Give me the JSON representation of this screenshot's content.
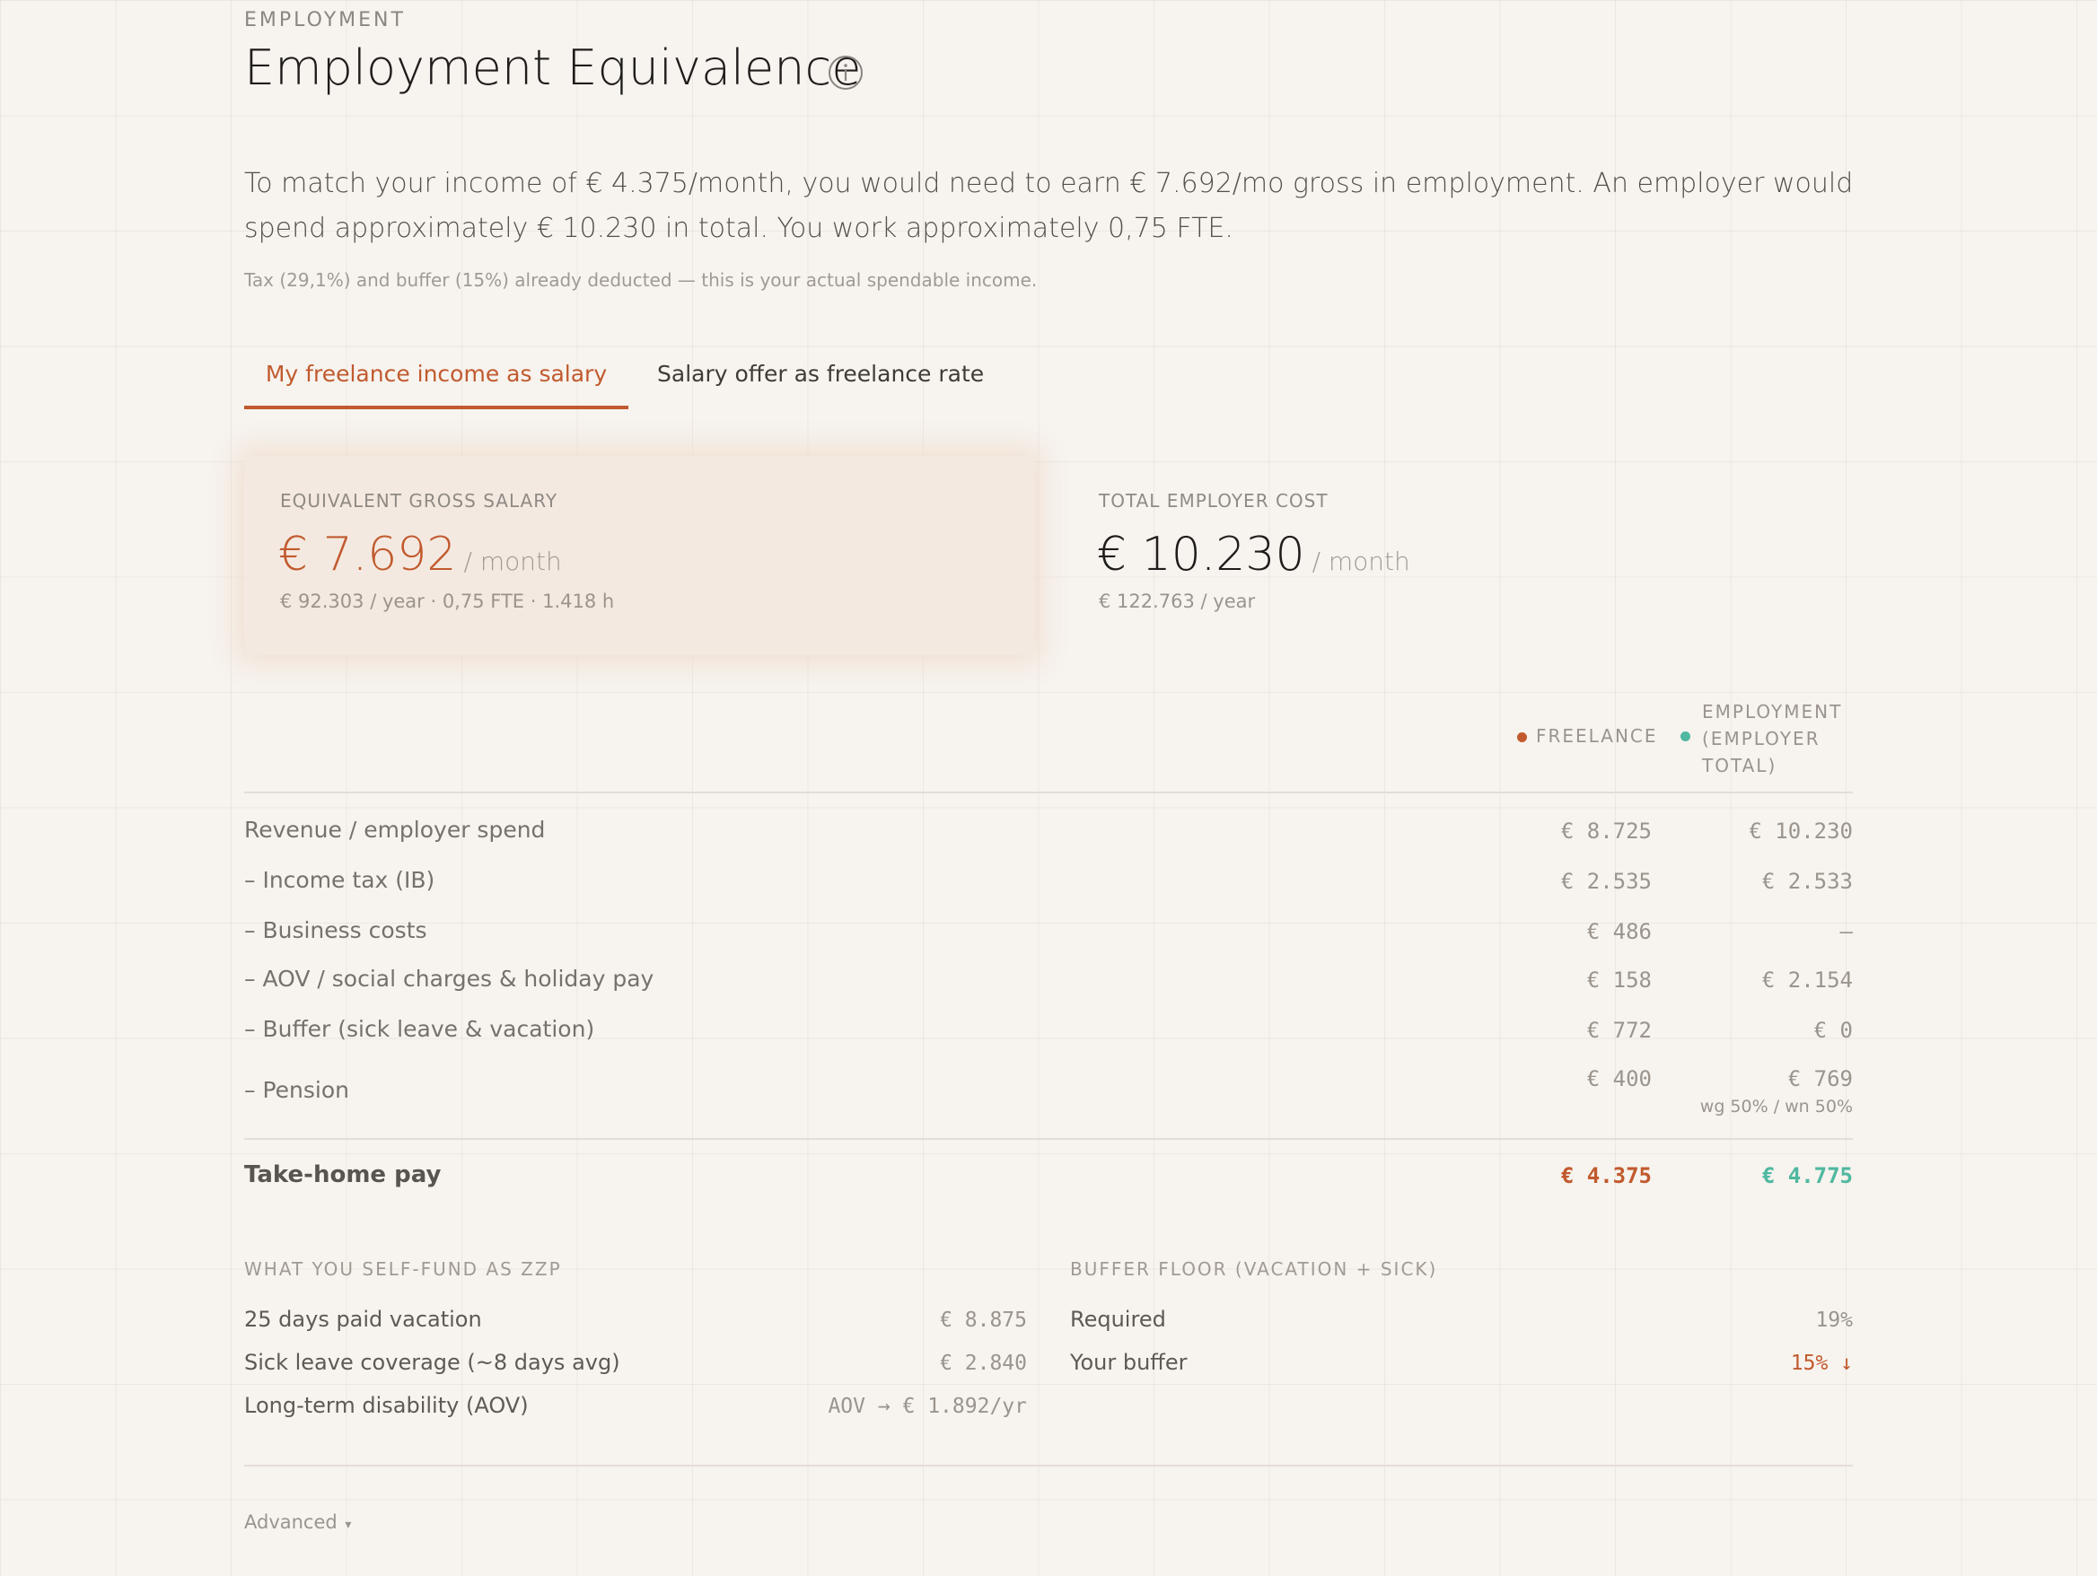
{
  "header": {
    "eyebrow": "EMPLOYMENT",
    "title": "Employment Equivalence"
  },
  "summary": {
    "text": "To match your income of € 4.375/month, you would need to earn € 7.692/mo gross in employment. An employer would spend approximately € 10.230 in total. You work approximately 0,75 FTE.",
    "note": "Tax (29,1%) and buffer (15%) already deducted — this is your actual spendable income."
  },
  "tabs": [
    {
      "label": "My freelance income as salary",
      "active": true
    },
    {
      "label": "Salary offer as freelance rate",
      "active": false
    }
  ],
  "cards": {
    "salary": {
      "label": "EQUIVALENT GROSS SALARY",
      "value": "€ 7.692",
      "unit": "/ month",
      "sub": "€ 92.303 / year · 0,75 FTE · 1.418 h"
    },
    "employer": {
      "label": "TOTAL EMPLOYER COST",
      "value": "€ 10.230",
      "unit": "/ month",
      "sub": "€ 122.763 / year"
    }
  },
  "legend": {
    "freelance": "FREELANCE",
    "employment_line1": "EMPLOYMENT",
    "employment_line2": "(EMPLOYER",
    "employment_line3": "TOTAL)"
  },
  "breakdown": {
    "rows": [
      {
        "label": "Revenue / employer spend",
        "freelance": "€ 8.725",
        "employment": "€ 10.230"
      },
      {
        "label": "– Income tax (IB)",
        "freelance": "€ 2.535",
        "employment": "€ 2.533"
      },
      {
        "label": "– Business costs",
        "freelance": "€ 486",
        "employment": "—"
      },
      {
        "label": "– AOV / social charges & holiday pay",
        "freelance": "€ 158",
        "employment": "€ 2.154"
      },
      {
        "label": "– Buffer (sick leave & vacation)",
        "freelance": "€ 772",
        "employment": "€ 0"
      },
      {
        "label": "– Pension",
        "freelance": "€ 400",
        "employment": "€ 769",
        "employment_note": "wg 50% / wn 50%"
      }
    ],
    "total": {
      "label": "Take-home pay",
      "freelance": "€ 4.375",
      "employment": "€ 4.775"
    }
  },
  "selffund": {
    "title": "WHAT YOU SELF-FUND AS ZZP",
    "items": [
      {
        "label": "25 days paid vacation",
        "value": "€ 8.875"
      },
      {
        "label": "Sick leave coverage (~8 days avg)",
        "value": "€ 2.840"
      },
      {
        "label": "Long-term disability (AOV)",
        "value": "AOV → € 1.892/yr"
      }
    ]
  },
  "buffer": {
    "title": "BUFFER FLOOR (VACATION + SICK)",
    "items": [
      {
        "label": "Required",
        "value": "19%"
      },
      {
        "label": "Your buffer",
        "value": "15% ↓"
      }
    ]
  },
  "advanced": {
    "label": "Advanced"
  },
  "colors": {
    "accent": "#c15a2e",
    "employment": "#4fb8a0",
    "background": "#f7f3ee"
  }
}
